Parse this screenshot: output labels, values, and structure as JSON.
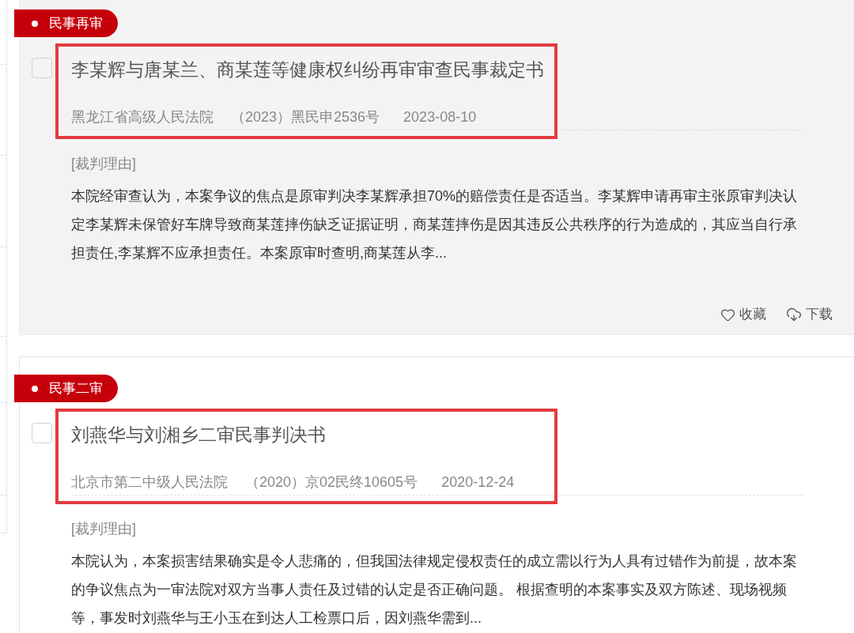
{
  "cases": [
    {
      "tag": "民事再审",
      "hovered": true,
      "checked": false,
      "highlighted": true,
      "title": "李某辉与唐某兰、商某莲等健康权纠纷再审审查民事裁定书",
      "court": "黑龙江省高级人民法院",
      "case_number": "（2023）黑民申2536号",
      "date": "2023-08-10",
      "reason_label": "[裁判理由]",
      "excerpt": "本院经审查认为，本案争议的焦点是原审判决李某辉承担70%的赔偿责任是否适当。李某辉申请再审主张原审判决认定李某辉未保管好车牌导致商某莲摔伤缺乏证据证明，商某莲摔伤是因其违反公共秩序的行为造成的，其应当自行承担责任,李某辉不应承担责任。本案原审时查明,商某莲从李...",
      "actions": [
        {
          "kind": "favorite",
          "label": "收藏"
        },
        {
          "kind": "download",
          "label": "下载"
        }
      ]
    },
    {
      "tag": "民事二审",
      "hovered": false,
      "checked": false,
      "highlighted": true,
      "title": "刘燕华与刘湘乡二审民事判决书",
      "court": "北京市第二中级人民法院",
      "case_number": "（2020）京02民终10605号",
      "date": "2020-12-24",
      "reason_label": "[裁判理由]",
      "excerpt": "本院认为，本案损害结果确实是令人悲痛的，但我国法律规定侵权责任的成立需以行为人具有过错作为前提，故本案的争议焦点为一审法院对双方当事人责任及过错的认定是否正确问题。 根据查明的本案事实及双方陈述、现场视频等，事发时刘燕华与王小玉在到达人工检票口后，因刘燕华需到..."
    }
  ]
}
